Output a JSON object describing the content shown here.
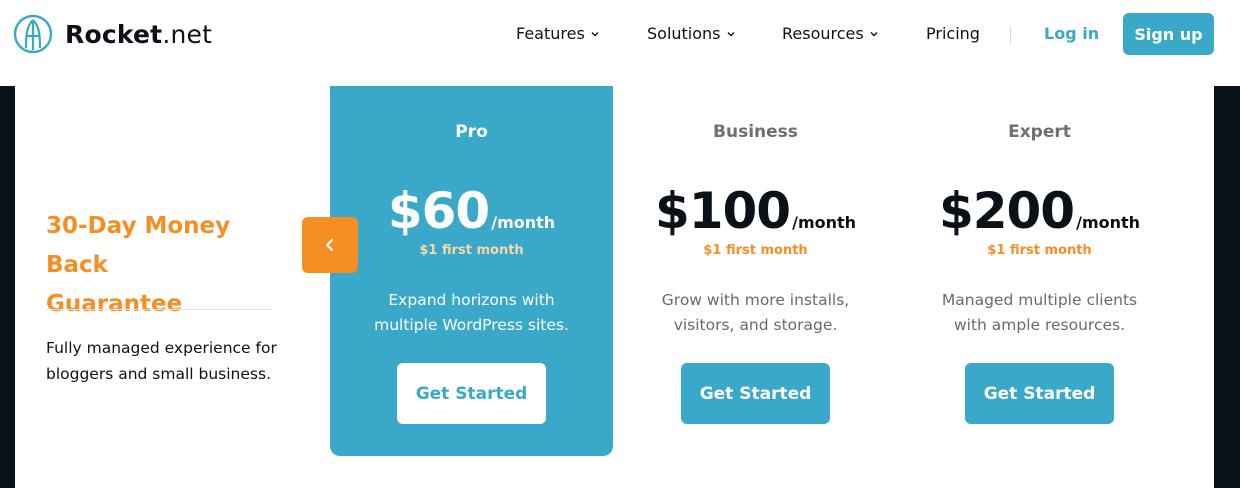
{
  "brand": {
    "name_bold": "Rocket",
    "name_rest": ".net"
  },
  "nav": {
    "items": [
      {
        "label": "Features",
        "has_dropdown": true
      },
      {
        "label": "Solutions",
        "has_dropdown": true
      },
      {
        "label": "Resources",
        "has_dropdown": true
      },
      {
        "label": "Pricing",
        "has_dropdown": false
      }
    ],
    "login": "Log in",
    "signup": "Sign up"
  },
  "guarantee": {
    "line1": "30-Day Money Back",
    "line2": "Guarantee",
    "desc_line1": "Fully managed experience for",
    "desc_line2": "bloggers and small business."
  },
  "carousel": {
    "prev_icon": "chevron-left-icon"
  },
  "plans": [
    {
      "name": "Pro",
      "price": "$60",
      "per": "/month",
      "first": "$1 first month",
      "desc_line1": "Expand horizons with",
      "desc_line2": "multiple WordPress sites.",
      "cta": "Get Started"
    },
    {
      "name": "Business",
      "price": "$100",
      "per": "/month",
      "first": "$1 first month",
      "desc_line1": "Grow with more installs,",
      "desc_line2": "visitors, and storage.",
      "cta": "Get Started"
    },
    {
      "name": "Expert",
      "price": "$200",
      "per": "/month",
      "first": "$1 first month",
      "desc_line1": "Managed multiple clients",
      "desc_line2": "with ample resources.",
      "cta": "Get Started"
    }
  ],
  "colors": {
    "accent": "#3aa9c9",
    "orange": "#f58f24",
    "dark": "#071219"
  }
}
